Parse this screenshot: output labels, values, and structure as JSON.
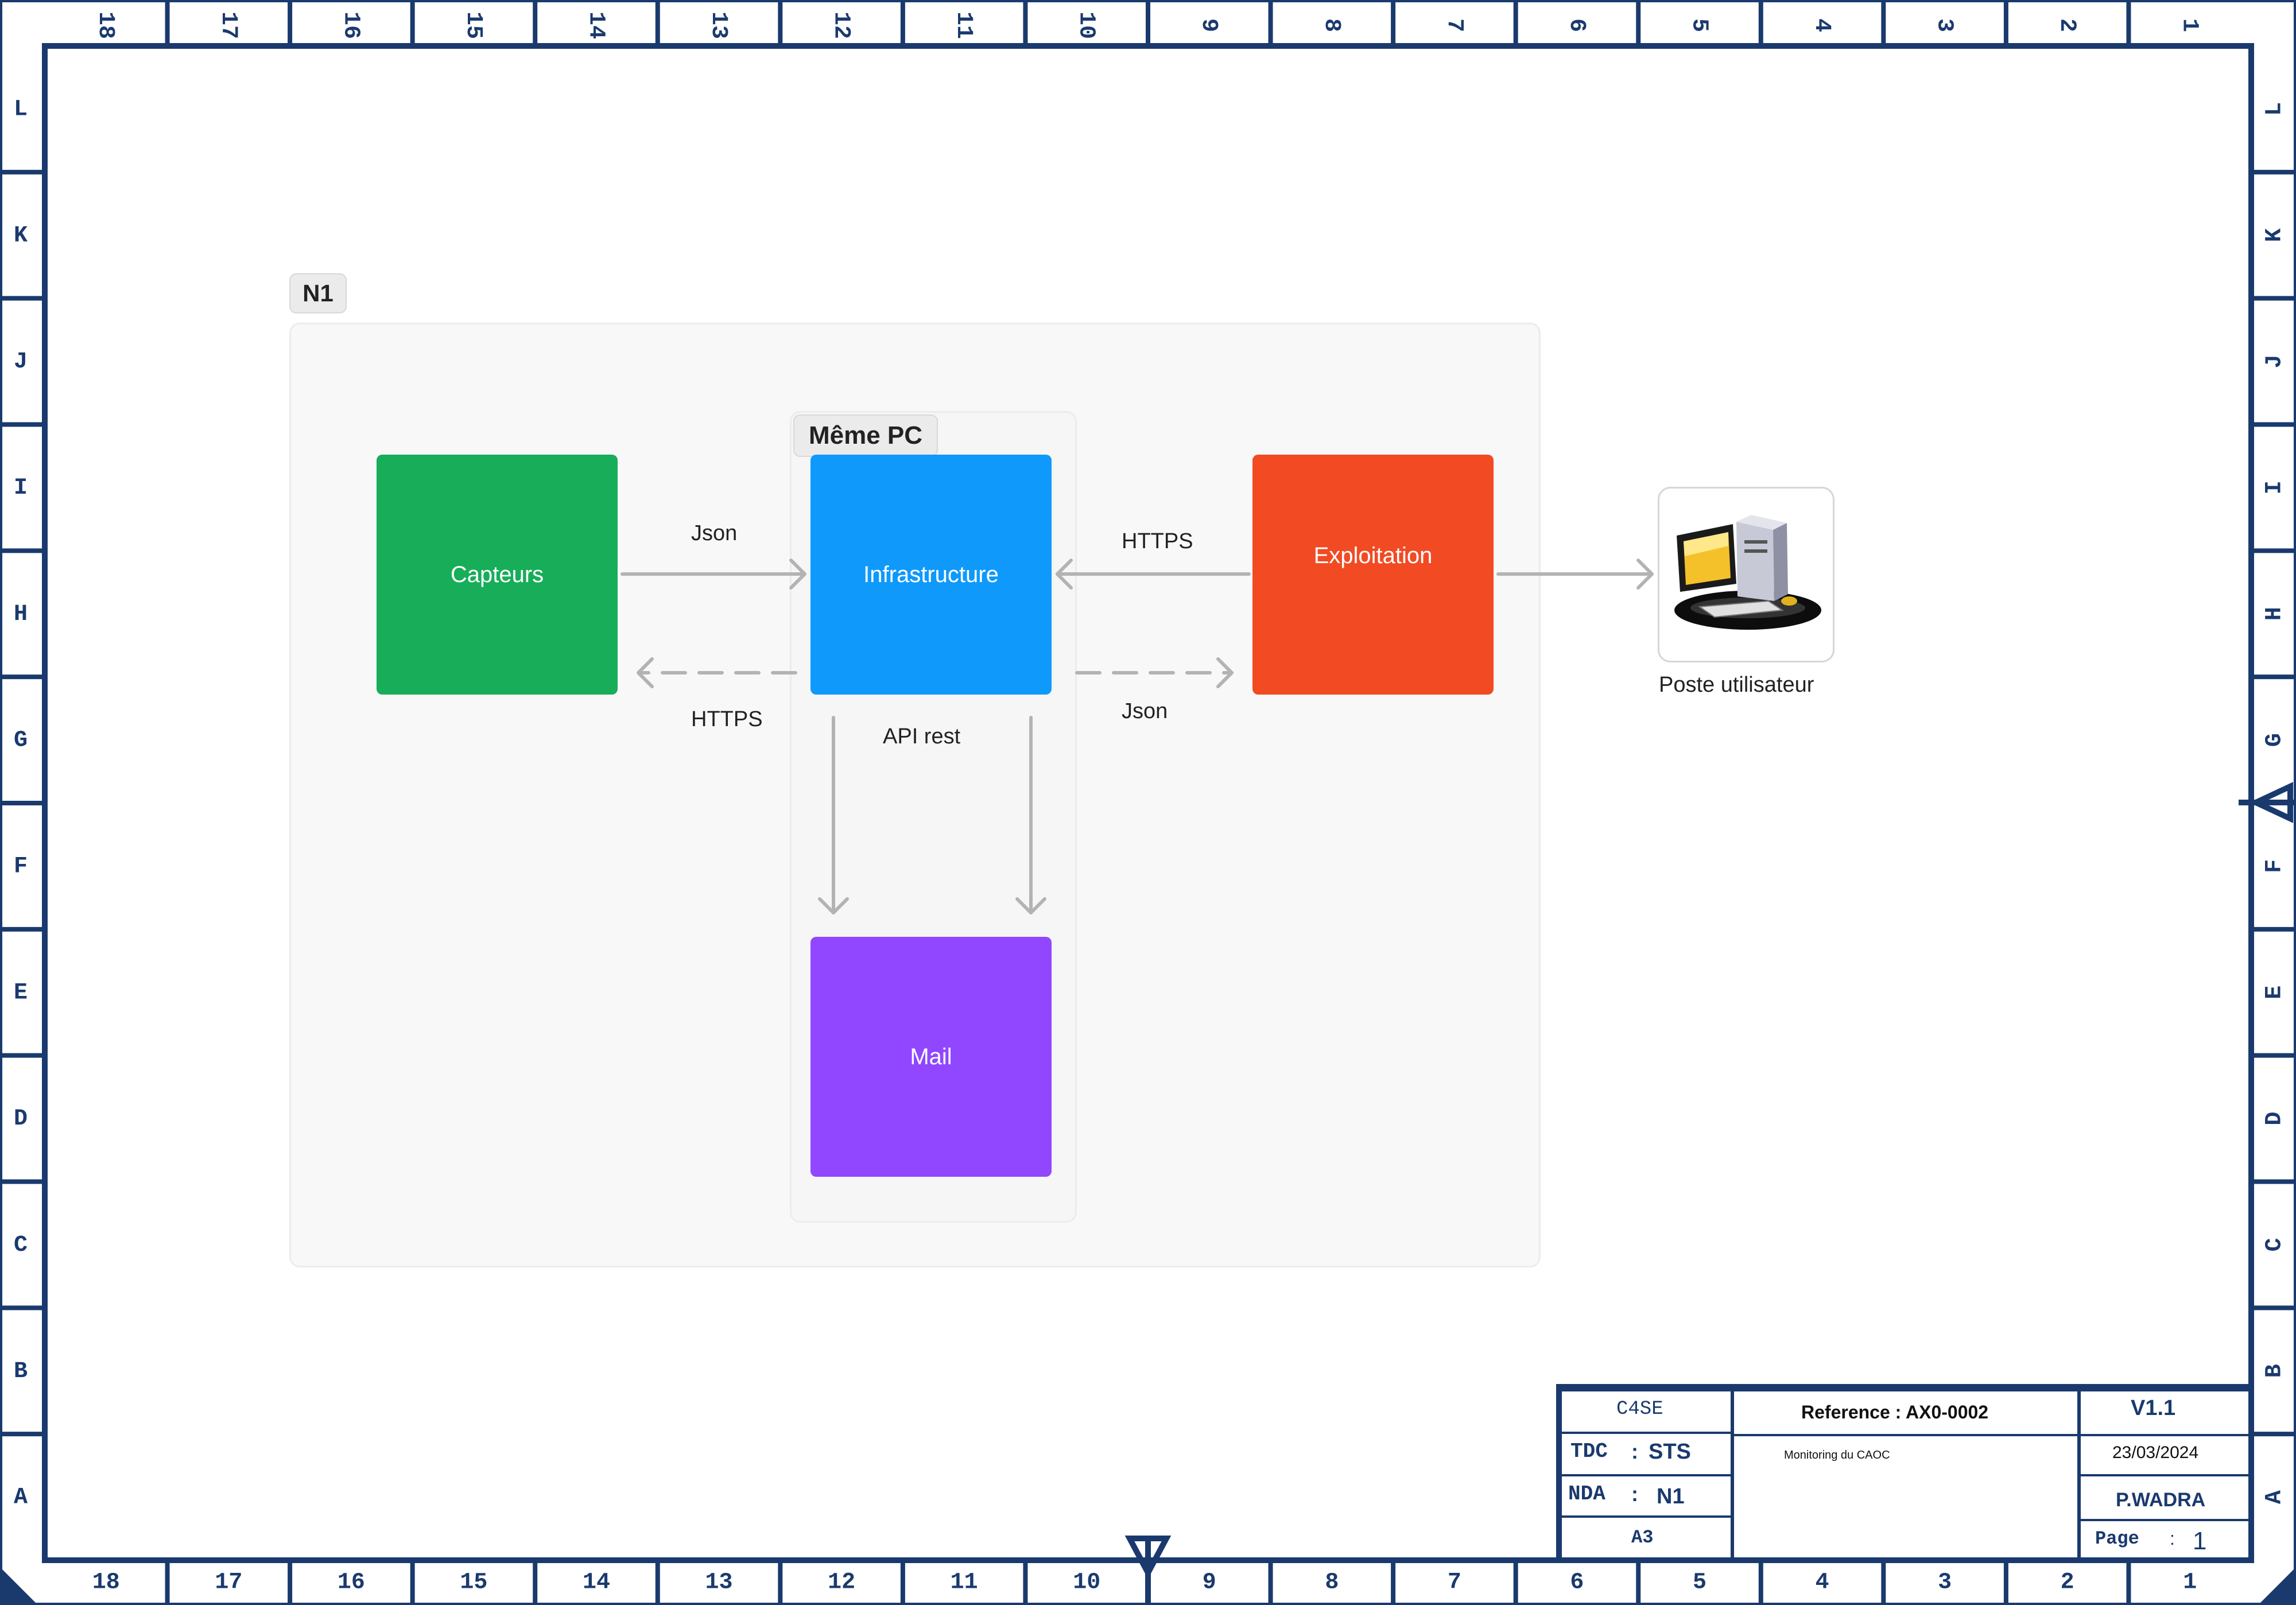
{
  "border": {
    "columns_top": [
      "18",
      "17",
      "16",
      "15",
      "14",
      "13",
      "12",
      "11",
      "10",
      "9",
      "8",
      "7",
      "6",
      "5",
      "4",
      "3",
      "2",
      "1"
    ],
    "columns_bottom": [
      "18",
      "17",
      "16",
      "15",
      "14",
      "13",
      "12",
      "11",
      "10",
      "9",
      "8",
      "7",
      "6",
      "5",
      "4",
      "3",
      "2",
      "1"
    ],
    "rows": [
      "L",
      "K",
      "J",
      "I",
      "H",
      "G",
      "F",
      "E",
      "D",
      "C",
      "B",
      "A"
    ]
  },
  "groups": {
    "n1": "N1",
    "same_pc": "Même PC"
  },
  "nodes": {
    "capteurs": {
      "label": "Capteurs",
      "color": "#17ad59"
    },
    "infrastructure": {
      "label": "Infrastructure",
      "color": "#0f99fb"
    },
    "exploitation": {
      "label": "Exploitation",
      "color": "#f24a23"
    },
    "mail": {
      "label": "Mail",
      "color": "#9047ff"
    },
    "poste": {
      "label": "Poste utilisateur",
      "icon": "desktop-computer-icon"
    }
  },
  "edges": {
    "capteurs_infra": "Json",
    "infra_capteurs": "HTTPS",
    "exploit_infra": "HTTPS",
    "infra_exploit": "Json",
    "infra_mail": "API rest"
  },
  "title_block": {
    "c4": "C4SE",
    "tdc_key": "TDC",
    "tdc_sep": ":",
    "tdc_value": "STS",
    "nda_key": "NDA",
    "nda_sep": ":",
    "nda_value": "N1",
    "format": "A3",
    "reference": "Reference : AX0-0002",
    "description": "Monitoring du CAOC",
    "version": "V1.1",
    "date": "23/03/2024",
    "author": "P.WADRA",
    "page_key": "Page",
    "page_sep": ":",
    "page_value": "1"
  },
  "colors": {
    "frame": "#1a3a6e",
    "arrow": "#b3b3b3"
  }
}
